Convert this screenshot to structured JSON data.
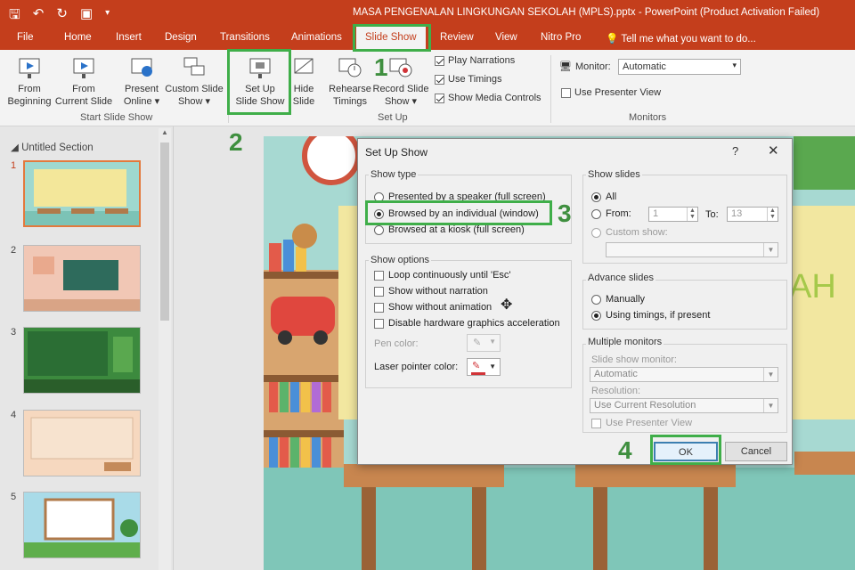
{
  "window": {
    "title": "MASA PENGENALAN LINGKUNGAN SEKOLAH (MPLS).pptx - PowerPoint (Product Activation Failed)"
  },
  "ribbon_tabs": [
    {
      "label": "File"
    },
    {
      "label": "Home"
    },
    {
      "label": "Insert"
    },
    {
      "label": "Design"
    },
    {
      "label": "Transitions"
    },
    {
      "label": "Animations"
    },
    {
      "label": "Slide Show"
    },
    {
      "label": "Review"
    },
    {
      "label": "View"
    },
    {
      "label": "Nitro Pro"
    }
  ],
  "tell_me": "Tell me what you want to do...",
  "ribbon": {
    "from_beginning": [
      "From",
      "Beginning"
    ],
    "from_current": [
      "From",
      "Current Slide"
    ],
    "present_online": [
      "Present",
      "Online ▾"
    ],
    "custom_slide_show": [
      "Custom Slide",
      "Show ▾"
    ],
    "group_start": "Start Slide Show",
    "set_up_slide_show": [
      "Set Up",
      "Slide Show"
    ],
    "hide_slide": [
      "Hide",
      "Slide"
    ],
    "rehearse_timings": [
      "Rehearse",
      "Timings"
    ],
    "record_slide_show": [
      "Record Slide",
      "Show ▾"
    ],
    "play_narrations": "Play Narrations",
    "use_timings": "Use Timings",
    "show_media_controls": "Show Media Controls",
    "group_setup": "Set Up",
    "monitor_label": "Monitor:",
    "monitor_value": "Automatic",
    "use_presenter_view": "Use Presenter View",
    "group_monitors": "Monitors"
  },
  "slides_pane": {
    "section": "Untitled Section",
    "numbers": [
      "1",
      "2",
      "3",
      "4",
      "5"
    ]
  },
  "dialog": {
    "title": "Set Up Show",
    "help": "?",
    "close": "✕",
    "show_type": {
      "legend": "Show type",
      "presented": "Presented by a speaker (full screen)",
      "browsed_individual": "Browsed by an individual (window)",
      "browsed_kiosk": "Browsed at a kiosk (full screen)"
    },
    "show_options": {
      "legend": "Show options",
      "loop": "Loop continuously until 'Esc'",
      "without_narration": "Show without narration",
      "without_animation": "Show without animation",
      "disable_hw": "Disable hardware graphics acceleration",
      "pen_color": "Pen color:",
      "laser_color": "Laser pointer color:"
    },
    "show_slides": {
      "legend": "Show slides",
      "all": "All",
      "from": "From:",
      "from_value": "1",
      "to": "To:",
      "to_value": "13",
      "custom_show": "Custom show:"
    },
    "advance_slides": {
      "legend": "Advance slides",
      "manually": "Manually",
      "using_timings": "Using timings, if present"
    },
    "multiple_monitors": {
      "legend": "Multiple monitors",
      "monitor_label": "Slide show monitor:",
      "monitor_value": "Automatic",
      "resolution_label": "Resolution:",
      "resolution_value": "Use Current Resolution",
      "presenter_view": "Use Presenter View"
    },
    "ok": "OK",
    "cancel": "Cancel"
  },
  "slide_banner_text": "AH",
  "steps": [
    "1",
    "2",
    "3",
    "4"
  ],
  "colors": {
    "accent": "#c43e1c",
    "highlight": "#3fae49",
    "step_text": "#3f8f3f"
  }
}
